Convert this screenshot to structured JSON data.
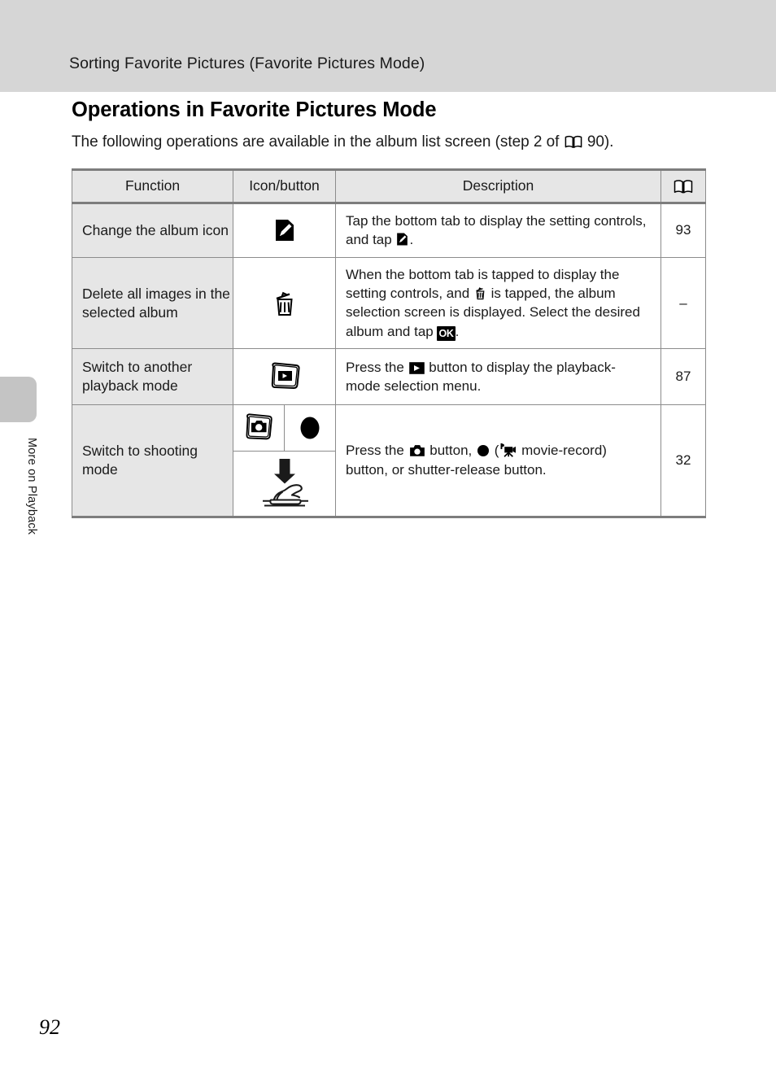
{
  "header": {
    "running_title": "Sorting Favorite Pictures (Favorite Pictures Mode)"
  },
  "side_tab": {
    "label": "More on Playback"
  },
  "page": {
    "heading": "Operations in Favorite Pictures Mode",
    "intro_before": "The following operations are available in the album list screen (step 2 of ",
    "intro_after": " 90).",
    "folio": "92"
  },
  "table": {
    "headers": {
      "function": "Function",
      "icon_button": "Icon/button",
      "description": "Description",
      "page_ref": "book-icon"
    },
    "rows": [
      {
        "function": "Change the album icon",
        "icons": [
          "edit-pencil-icon"
        ],
        "description_parts": [
          "Tap the bottom tab to display the setting controls, and tap ",
          "edit-pencil-icon",
          "."
        ],
        "desc_text_1": "Tap the bottom tab to display the setting controls, and tap ",
        "desc_text_2": ".",
        "page": "93"
      },
      {
        "function": "Delete all images in the selected album",
        "icons": [
          "trash-icon"
        ],
        "desc_text_1": "When the bottom tab is tapped to display the setting controls, and ",
        "desc_text_2": " is tapped, the album selection screen is displayed. Select the desired album and tap ",
        "ok_label": "OK",
        "desc_text_3": ".",
        "page": "–"
      },
      {
        "function": "Switch to another playback mode",
        "icons": [
          "playback-button-icon"
        ],
        "desc_text_1": "Press the ",
        "desc_text_2": " button to display the playback-mode selection menu.",
        "page": "87"
      },
      {
        "function": "Switch to shooting mode",
        "icons": [
          "camera-button-icon",
          "movie-record-circle-icon",
          "shutter-release-icon"
        ],
        "desc_text_1": "Press the ",
        "desc_text_2": " button, ",
        "desc_text_3": " (",
        "desc_text_4": " movie-record) button, or shutter-release button.",
        "page": "32"
      }
    ]
  },
  "colors": {
    "header_band": "#d6d6d6",
    "table_header_bg": "#e6e6e6",
    "function_col_bg": "#e6e6e6",
    "rule": "#7d7d7d",
    "tab_gray": "#c4c4c4"
  }
}
